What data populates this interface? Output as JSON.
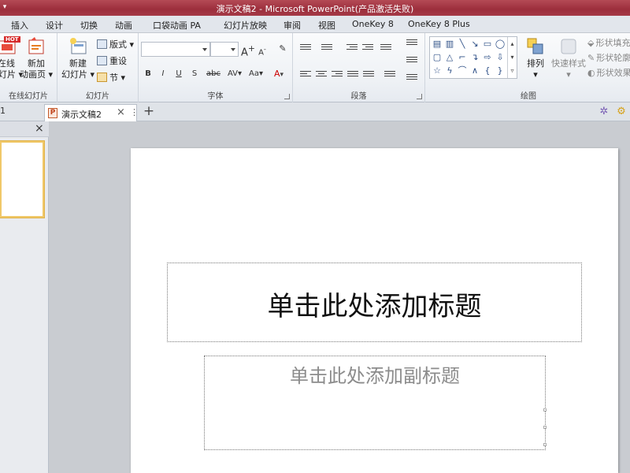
{
  "window": {
    "title": "演示文稿2 - Microsoft PowerPoint(产品激活失败)"
  },
  "ribbon_tabs": [
    "插入",
    "设计",
    "切换",
    "动画",
    "口袋动画 PA",
    "幻灯片放映",
    "审阅",
    "视图",
    "OneKey 8",
    "OneKey 8 Plus"
  ],
  "ribbon": {
    "online": {
      "badge": "HOT",
      "label1": "在线",
      "label2": "幻灯片",
      "group": "在线幻灯片"
    },
    "new_anim": {
      "label1": "新加",
      "label2": "动画页"
    },
    "slides": {
      "new_label1": "新建",
      "new_label2": "幻灯片",
      "layout": "版式",
      "reset": "重设",
      "section": "节",
      "group": "幻灯片"
    },
    "font": {
      "group": "字体",
      "bold": "B",
      "italic": "I",
      "underline": "U",
      "shadow": "S",
      "strike": "abc",
      "spacing": "AV",
      "case": "Aa",
      "color": "A",
      "grow": "A",
      "shrink": "A"
    },
    "paragraph": {
      "group": "段落"
    },
    "drawing": {
      "group": "绘图",
      "arrange": "排列",
      "quick_styles": "快速样式",
      "fill": "形状填充",
      "outline": "形状轮廓",
      "effects": "形状效果"
    }
  },
  "doc_tabs": {
    "left_stub": "1",
    "active": "演示文稿2",
    "close": "×",
    "menu": "⋮",
    "new": "+"
  },
  "left_panel": {
    "close": "×"
  },
  "slide": {
    "title_placeholder": "单击此处添加标题",
    "subtitle_placeholder": "单击此处添加副标题"
  },
  "colors": {
    "titlebar": "#a53a47",
    "ribbon": "#eef1f5",
    "thumb_border": "#f0c869"
  }
}
